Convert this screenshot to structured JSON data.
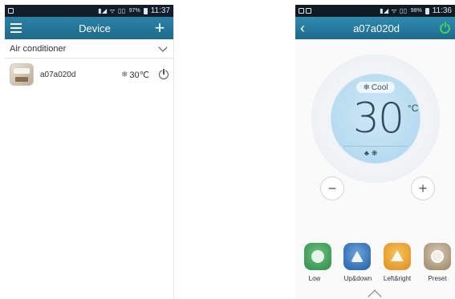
{
  "left_screen": {
    "status_bar": {
      "battery": "97%",
      "time": "11:37"
    },
    "title": "Device",
    "category": "Air conditioner",
    "device": {
      "name": "a07a020d",
      "mode_icon": "snowflake-icon",
      "temperature": "30℃"
    }
  },
  "right_screen": {
    "status_bar": {
      "battery": "98%",
      "time": "11:36"
    },
    "title": "a07a020d",
    "mode_label": "Cool",
    "temperature": "30",
    "unit": "°C",
    "power_color": "#3bd45a",
    "decrease": "−",
    "increase": "+",
    "functions": [
      {
        "label": "Low"
      },
      {
        "label": "Up&down"
      },
      {
        "label": "Left&right"
      },
      {
        "label": "Preset"
      }
    ]
  },
  "colors": {
    "accent": "#1e6a8d",
    "dial": "#b6dbf0"
  }
}
